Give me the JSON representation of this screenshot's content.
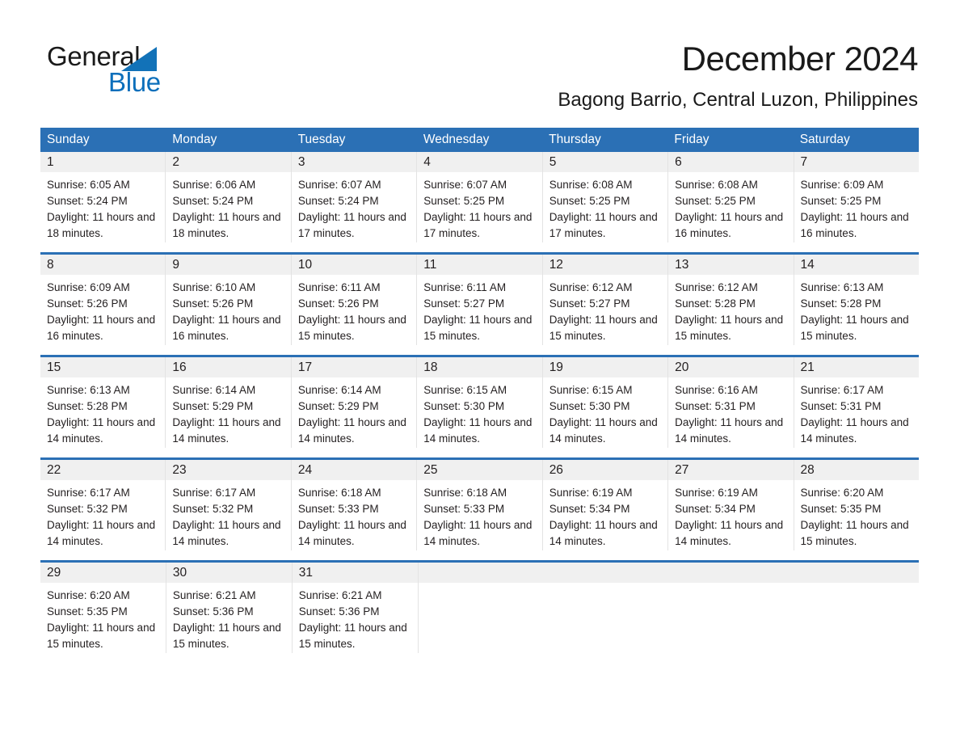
{
  "brand": {
    "line1": "General",
    "line2": "Blue",
    "triangle_color": "#1272b8"
  },
  "header": {
    "month_title": "December 2024",
    "location": "Bagong Barrio, Central Luzon, Philippines"
  },
  "theme": {
    "header_blue": "#2b70b5",
    "day_band_gray": "#f0f0f0",
    "text": "#231f20",
    "column_divider": "#e3e3e3"
  },
  "weekdays": [
    "Sunday",
    "Monday",
    "Tuesday",
    "Wednesday",
    "Thursday",
    "Friday",
    "Saturday"
  ],
  "weeks": [
    [
      {
        "day": "1",
        "sunrise": "Sunrise: 6:05 AM",
        "sunset": "Sunset: 5:24 PM",
        "daylight": "Daylight: 11 hours and 18 minutes."
      },
      {
        "day": "2",
        "sunrise": "Sunrise: 6:06 AM",
        "sunset": "Sunset: 5:24 PM",
        "daylight": "Daylight: 11 hours and 18 minutes."
      },
      {
        "day": "3",
        "sunrise": "Sunrise: 6:07 AM",
        "sunset": "Sunset: 5:24 PM",
        "daylight": "Daylight: 11 hours and 17 minutes."
      },
      {
        "day": "4",
        "sunrise": "Sunrise: 6:07 AM",
        "sunset": "Sunset: 5:25 PM",
        "daylight": "Daylight: 11 hours and 17 minutes."
      },
      {
        "day": "5",
        "sunrise": "Sunrise: 6:08 AM",
        "sunset": "Sunset: 5:25 PM",
        "daylight": "Daylight: 11 hours and 17 minutes."
      },
      {
        "day": "6",
        "sunrise": "Sunrise: 6:08 AM",
        "sunset": "Sunset: 5:25 PM",
        "daylight": "Daylight: 11 hours and 16 minutes."
      },
      {
        "day": "7",
        "sunrise": "Sunrise: 6:09 AM",
        "sunset": "Sunset: 5:25 PM",
        "daylight": "Daylight: 11 hours and 16 minutes."
      }
    ],
    [
      {
        "day": "8",
        "sunrise": "Sunrise: 6:09 AM",
        "sunset": "Sunset: 5:26 PM",
        "daylight": "Daylight: 11 hours and 16 minutes."
      },
      {
        "day": "9",
        "sunrise": "Sunrise: 6:10 AM",
        "sunset": "Sunset: 5:26 PM",
        "daylight": "Daylight: 11 hours and 16 minutes."
      },
      {
        "day": "10",
        "sunrise": "Sunrise: 6:11 AM",
        "sunset": "Sunset: 5:26 PM",
        "daylight": "Daylight: 11 hours and 15 minutes."
      },
      {
        "day": "11",
        "sunrise": "Sunrise: 6:11 AM",
        "sunset": "Sunset: 5:27 PM",
        "daylight": "Daylight: 11 hours and 15 minutes."
      },
      {
        "day": "12",
        "sunrise": "Sunrise: 6:12 AM",
        "sunset": "Sunset: 5:27 PM",
        "daylight": "Daylight: 11 hours and 15 minutes."
      },
      {
        "day": "13",
        "sunrise": "Sunrise: 6:12 AM",
        "sunset": "Sunset: 5:28 PM",
        "daylight": "Daylight: 11 hours and 15 minutes."
      },
      {
        "day": "14",
        "sunrise": "Sunrise: 6:13 AM",
        "sunset": "Sunset: 5:28 PM",
        "daylight": "Daylight: 11 hours and 15 minutes."
      }
    ],
    [
      {
        "day": "15",
        "sunrise": "Sunrise: 6:13 AM",
        "sunset": "Sunset: 5:28 PM",
        "daylight": "Daylight: 11 hours and 14 minutes."
      },
      {
        "day": "16",
        "sunrise": "Sunrise: 6:14 AM",
        "sunset": "Sunset: 5:29 PM",
        "daylight": "Daylight: 11 hours and 14 minutes."
      },
      {
        "day": "17",
        "sunrise": "Sunrise: 6:14 AM",
        "sunset": "Sunset: 5:29 PM",
        "daylight": "Daylight: 11 hours and 14 minutes."
      },
      {
        "day": "18",
        "sunrise": "Sunrise: 6:15 AM",
        "sunset": "Sunset: 5:30 PM",
        "daylight": "Daylight: 11 hours and 14 minutes."
      },
      {
        "day": "19",
        "sunrise": "Sunrise: 6:15 AM",
        "sunset": "Sunset: 5:30 PM",
        "daylight": "Daylight: 11 hours and 14 minutes."
      },
      {
        "day": "20",
        "sunrise": "Sunrise: 6:16 AM",
        "sunset": "Sunset: 5:31 PM",
        "daylight": "Daylight: 11 hours and 14 minutes."
      },
      {
        "day": "21",
        "sunrise": "Sunrise: 6:17 AM",
        "sunset": "Sunset: 5:31 PM",
        "daylight": "Daylight: 11 hours and 14 minutes."
      }
    ],
    [
      {
        "day": "22",
        "sunrise": "Sunrise: 6:17 AM",
        "sunset": "Sunset: 5:32 PM",
        "daylight": "Daylight: 11 hours and 14 minutes."
      },
      {
        "day": "23",
        "sunrise": "Sunrise: 6:17 AM",
        "sunset": "Sunset: 5:32 PM",
        "daylight": "Daylight: 11 hours and 14 minutes."
      },
      {
        "day": "24",
        "sunrise": "Sunrise: 6:18 AM",
        "sunset": "Sunset: 5:33 PM",
        "daylight": "Daylight: 11 hours and 14 minutes."
      },
      {
        "day": "25",
        "sunrise": "Sunrise: 6:18 AM",
        "sunset": "Sunset: 5:33 PM",
        "daylight": "Daylight: 11 hours and 14 minutes."
      },
      {
        "day": "26",
        "sunrise": "Sunrise: 6:19 AM",
        "sunset": "Sunset: 5:34 PM",
        "daylight": "Daylight: 11 hours and 14 minutes."
      },
      {
        "day": "27",
        "sunrise": "Sunrise: 6:19 AM",
        "sunset": "Sunset: 5:34 PM",
        "daylight": "Daylight: 11 hours and 14 minutes."
      },
      {
        "day": "28",
        "sunrise": "Sunrise: 6:20 AM",
        "sunset": "Sunset: 5:35 PM",
        "daylight": "Daylight: 11 hours and 15 minutes."
      }
    ],
    [
      {
        "day": "29",
        "sunrise": "Sunrise: 6:20 AM",
        "sunset": "Sunset: 5:35 PM",
        "daylight": "Daylight: 11 hours and 15 minutes."
      },
      {
        "day": "30",
        "sunrise": "Sunrise: 6:21 AM",
        "sunset": "Sunset: 5:36 PM",
        "daylight": "Daylight: 11 hours and 15 minutes."
      },
      {
        "day": "31",
        "sunrise": "Sunrise: 6:21 AM",
        "sunset": "Sunset: 5:36 PM",
        "daylight": "Daylight: 11 hours and 15 minutes."
      },
      {
        "day": "",
        "sunrise": "",
        "sunset": "",
        "daylight": ""
      },
      {
        "day": "",
        "sunrise": "",
        "sunset": "",
        "daylight": ""
      },
      {
        "day": "",
        "sunrise": "",
        "sunset": "",
        "daylight": ""
      },
      {
        "day": "",
        "sunrise": "",
        "sunset": "",
        "daylight": ""
      }
    ]
  ]
}
